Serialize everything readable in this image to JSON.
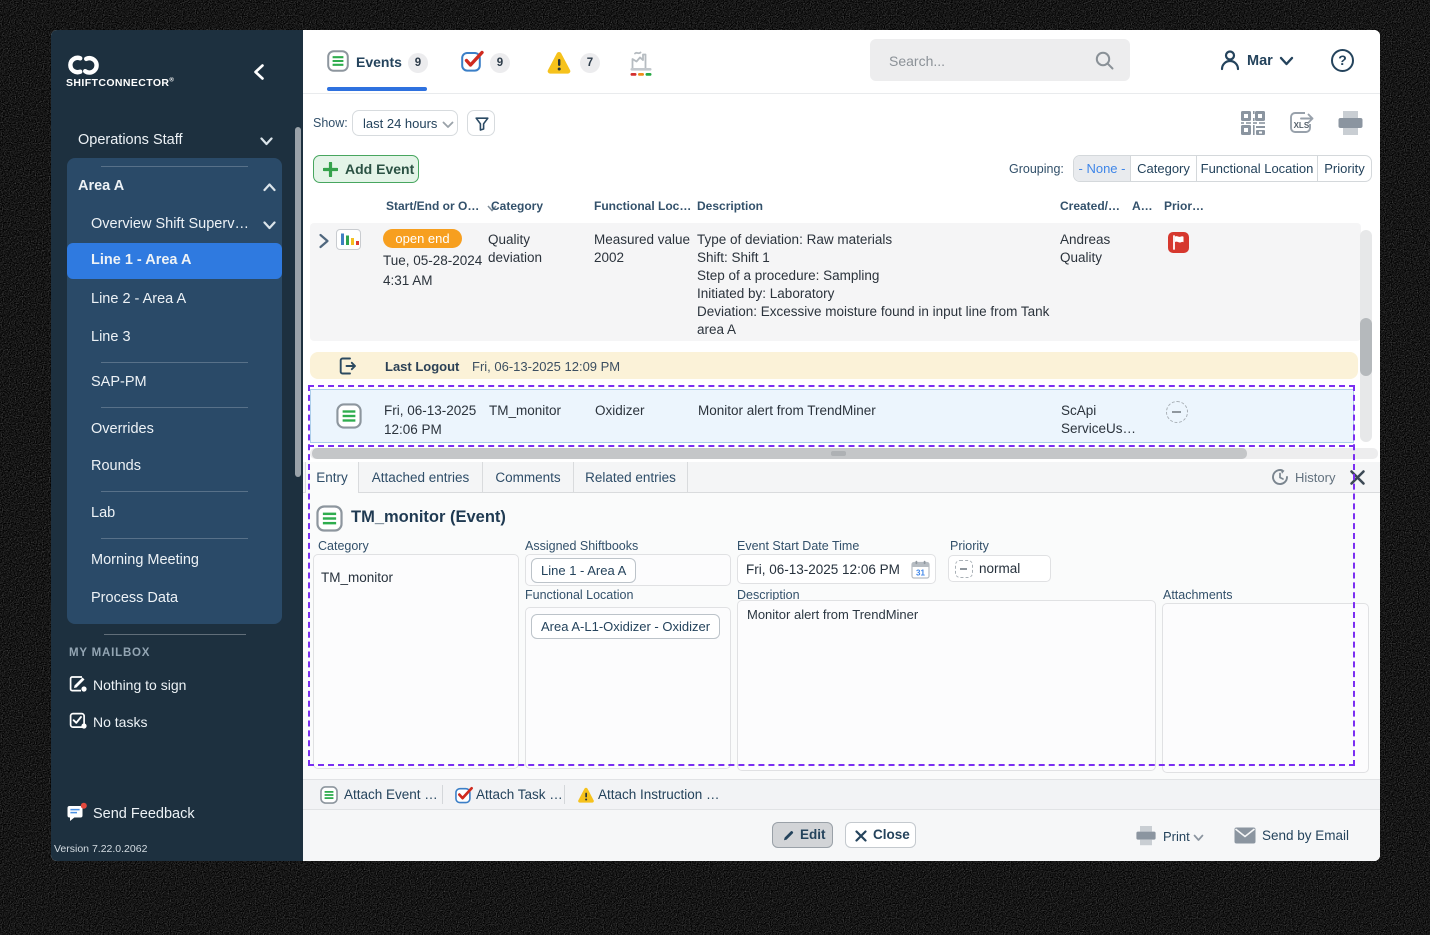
{
  "colors": {
    "sidebar_bg": "#1d303f",
    "sidebar_panel_bg": "#2a4a68",
    "selected_item_blue": "#2f7ae0",
    "accent_blue": "#2e71df",
    "green": "#2fad4e",
    "orange_pill": "#f79f1f",
    "red_flag": "#d6382e",
    "warning_yellow": "#f6c21c",
    "selection_purple": "#7b2ff2",
    "logout_row_bg": "#fbf2d8",
    "selected_row_bg": "#ecf5fd"
  },
  "sidebar": {
    "brand": "SHIFTCONNECTOR",
    "operations_staff": "Operations Staff",
    "group_header": "Area A",
    "overview": "Overview Shift Superv…",
    "items": [
      "Line 1 - Area A",
      "Line 2 - Area A",
      "Line 3",
      "SAP-PM",
      "Overrides",
      "Rounds",
      "Lab",
      "Morning Meeting",
      "Process Data"
    ],
    "mailbox_header": "MY MAILBOX",
    "nothing_to_sign": "Nothing to sign",
    "no_tasks": "No tasks",
    "send_feedback": "Send Feedback",
    "version": "Version 7.22.0.2062"
  },
  "topbar": {
    "events_tab": "Events",
    "events_badge": "9",
    "tasks_badge": "9",
    "instructions_badge": "7",
    "search_placeholder": "Search...",
    "user": "Mar"
  },
  "toolbar": {
    "show_label": "Show:",
    "show_value": "last 24 hours",
    "add_event": "Add Event",
    "grouping_label": "Grouping:",
    "grouping_options": [
      "- None -",
      "Category",
      "Functional Location",
      "Priority"
    ]
  },
  "table": {
    "columns": [
      "Start/End or O…",
      "Category",
      "Functional Loc…",
      "Description",
      "Created/…",
      "A…",
      "Prior…"
    ],
    "row_event": {
      "status": "open end",
      "date": "Tue, 05-28-2024",
      "time": "4:31 AM",
      "category": "Quality deviation",
      "functional_location": "Measured value 2002",
      "description": "Type of deviation: Raw materials\nShift: Shift 1\nStep of a procedure: Sampling\nInitiated by: Laboratory\nDeviation: Excessive moisture found in input line from Tank area A",
      "created_by": "Andreas Quality"
    },
    "row_logout": {
      "label": "Last Logout",
      "timestamp": "Fri, 06-13-2025 12:09 PM"
    },
    "row_selected": {
      "date": "Fri, 06-13-2025",
      "time": "12:06 PM",
      "category": "TM_monitor",
      "functional_location": "Oxidizer",
      "description": "Monitor alert from TrendMiner",
      "created_by_line1": "ScApi",
      "created_by_line2": "ServiceUs…"
    }
  },
  "detail": {
    "tabs": [
      "Entry",
      "Attached entries",
      "Comments",
      "Related entries"
    ],
    "history": "History",
    "title": "TM_monitor (Event)",
    "category_label": "Category",
    "category_value": "TM_monitor",
    "shiftbooks_label": "Assigned Shiftbooks",
    "shiftbooks_value": "Line 1 - Area A",
    "start_label": "Event Start Date Time",
    "start_value": "Fri, 06-13-2025 12:06 PM",
    "priority_label": "Priority",
    "priority_value": "normal",
    "functional_label": "Functional Location",
    "functional_value": "Area A-L1-Oxidizer - Oxidizer",
    "description_label": "Description",
    "description_value": "Monitor alert from TrendMiner",
    "attachments_label": "Attachments",
    "attach_event": "Attach Event …",
    "attach_task": "Attach Task …",
    "attach_instruction": "Attach Instruction …",
    "edit": "Edit",
    "close": "Close",
    "print": "Print",
    "send_by_email": "Send by Email"
  }
}
